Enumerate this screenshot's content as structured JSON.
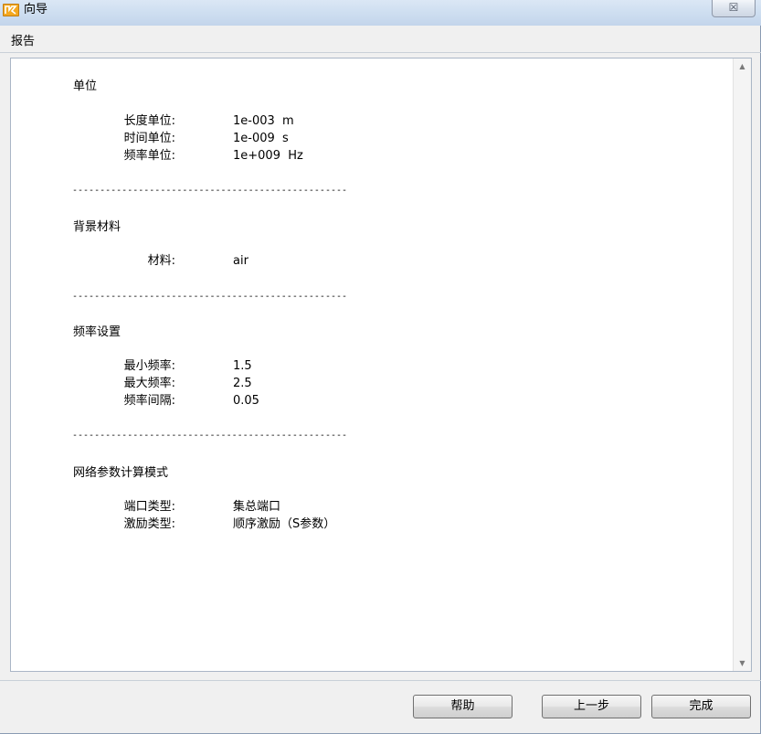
{
  "window": {
    "title": "向导",
    "close_glyph": "☒"
  },
  "section": {
    "header": "报告"
  },
  "report": {
    "units": {
      "title": "单位",
      "rows": [
        {
          "label": "长度单位:",
          "value": "1e-003  m"
        },
        {
          "label": "时间单位:",
          "value": "1e-009  s"
        },
        {
          "label": "频率单位:",
          "value": "1e+009  Hz"
        }
      ]
    },
    "background": {
      "title": "背景材料",
      "rows": [
        {
          "label": "材料:",
          "value": "air"
        }
      ]
    },
    "frequency": {
      "title": "频率设置",
      "rows": [
        {
          "label": "最小频率:",
          "value": "1.5"
        },
        {
          "label": "最大频率:",
          "value": "2.5"
        },
        {
          "label": "频率间隔:",
          "value": "0.05"
        }
      ]
    },
    "network": {
      "title": "网络参数计算模式",
      "rows": [
        {
          "label": "端口类型:",
          "value": "集总端口"
        },
        {
          "label": "激励类型:",
          "value": "顺序激励（S参数）"
        }
      ]
    },
    "separator": "--------------------------------------------------"
  },
  "scrollbar": {
    "up_glyph": "▲",
    "down_glyph": "▼"
  },
  "buttons": {
    "help": "帮助",
    "back": "上一步",
    "finish": "完成"
  }
}
